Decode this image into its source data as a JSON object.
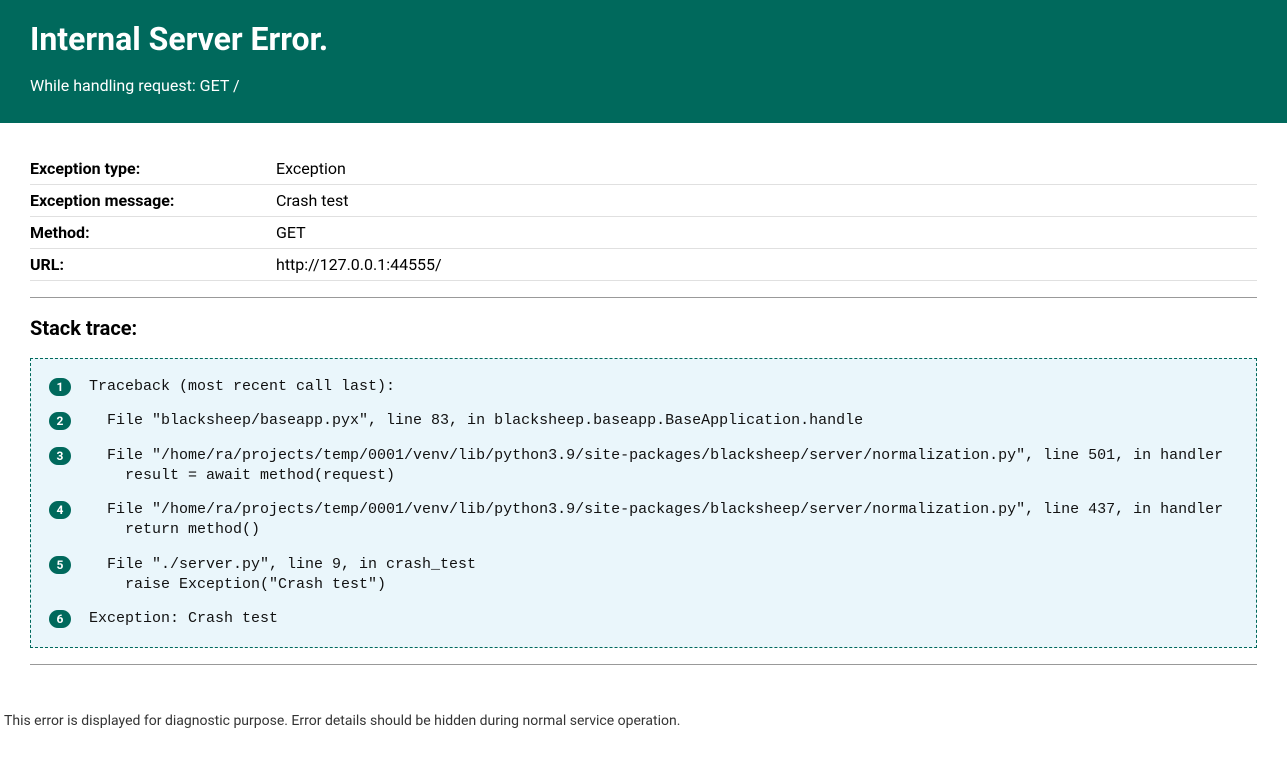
{
  "header": {
    "title": "Internal Server Error.",
    "subtitle": "While handling request: GET /"
  },
  "info_rows": [
    {
      "label": "Exception type:",
      "value": "Exception"
    },
    {
      "label": "Exception message:",
      "value": "Crash test"
    },
    {
      "label": "Method:",
      "value": "GET"
    },
    {
      "label": "URL:",
      "value": "http://127.0.0.1:44555/"
    }
  ],
  "stack_trace_title": "Stack trace:",
  "trace_lines": [
    {
      "num": "1",
      "text": "Traceback (most recent call last):"
    },
    {
      "num": "2",
      "text": "  File \"blacksheep/baseapp.pyx\", line 83, in blacksheep.baseapp.BaseApplication.handle"
    },
    {
      "num": "3",
      "text": "  File \"/home/ra/projects/temp/0001/venv/lib/python3.9/site-packages/blacksheep/server/normalization.py\", line 501, in handler\n    result = await method(request)"
    },
    {
      "num": "4",
      "text": "  File \"/home/ra/projects/temp/0001/venv/lib/python3.9/site-packages/blacksheep/server/normalization.py\", line 437, in handler\n    return method()"
    },
    {
      "num": "5",
      "text": "  File \"./server.py\", line 9, in crash_test\n    raise Exception(\"Crash test\")"
    },
    {
      "num": "6",
      "text": "Exception: Crash test"
    }
  ],
  "footer_note": "This error is displayed for diagnostic purpose. Error details should be hidden during normal service operation."
}
